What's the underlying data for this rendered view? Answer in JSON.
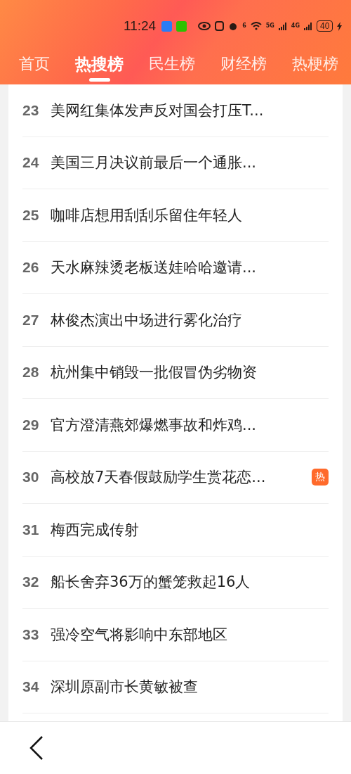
{
  "status_bar": {
    "time": "11:24",
    "wifi_label": "6",
    "sim1_label": "5G",
    "sim2_label": "4G",
    "battery": "40"
  },
  "tabs": [
    {
      "label": "首页",
      "selected": false
    },
    {
      "label": "热搜榜",
      "selected": true
    },
    {
      "label": "民生榜",
      "selected": false
    },
    {
      "label": "财经榜",
      "selected": false
    },
    {
      "label": "热梗榜",
      "selected": false
    }
  ],
  "list": [
    {
      "rank": "23",
      "title": "美网红集体发声反对国会打压T..."
    },
    {
      "rank": "24",
      "title": "美国三月决议前最后一个通胀..."
    },
    {
      "rank": "25",
      "title": "咖啡店想用刮刮乐留住年轻人"
    },
    {
      "rank": "26",
      "title": "天水麻辣烫老板送娃哈哈邀请..."
    },
    {
      "rank": "27",
      "title": "林俊杰演出中场进行雾化治疗"
    },
    {
      "rank": "28",
      "title": "杭州集中销毁一批假冒伪劣物资"
    },
    {
      "rank": "29",
      "title": "官方澄清燕郊爆燃事故和炸鸡..."
    },
    {
      "rank": "30",
      "title": "高校放7天春假鼓励学生赏花恋...",
      "badge": "热"
    },
    {
      "rank": "31",
      "title": "梅西完成传射"
    },
    {
      "rank": "32",
      "title": "船长舍弃36万的蟹笼救起16人"
    },
    {
      "rank": "33",
      "title": "强冷空气将影响中东部地区"
    },
    {
      "rank": "34",
      "title": "深圳原副市长黄敏被查"
    }
  ]
}
